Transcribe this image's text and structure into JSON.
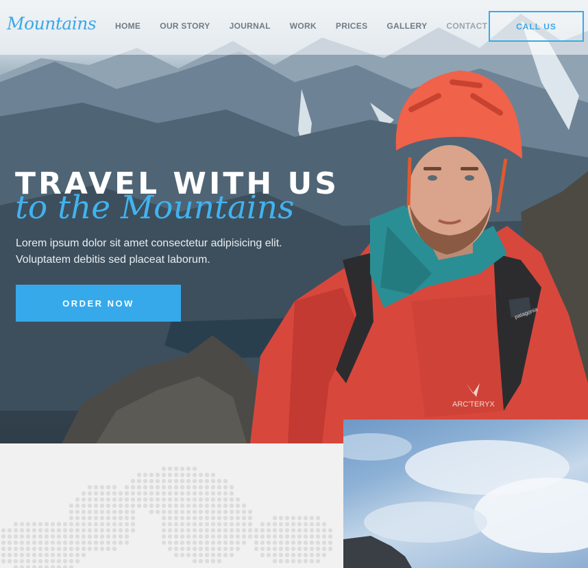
{
  "brand": {
    "logo_text": "Mountains"
  },
  "nav": {
    "items": [
      "HOME",
      "OUR STORY",
      "JOURNAL",
      "WORK",
      "PRICES",
      "GALLERY",
      "CONTACT"
    ],
    "cta_label": "CALL US"
  },
  "hero": {
    "title": "TRAVEL WITH US",
    "subtitle": "to the Mountains",
    "lead": "Lorem ipsum dolor sit amet consectetur adipisicing elit. Voluptatem debitis sed placeat laborum.",
    "button_label": "ORDER NOW",
    "jacket_logo_text": "ARC'TERYX",
    "strap_label": "patagonia"
  },
  "colors": {
    "accent": "#36a9ea",
    "jacket": "#d8473c",
    "helmet": "#f0624a",
    "scarf": "#2a8f94",
    "map_dots": "#dcdcdc"
  },
  "icons": {
    "jacket_logo": "arcteryx-logo-icon"
  }
}
